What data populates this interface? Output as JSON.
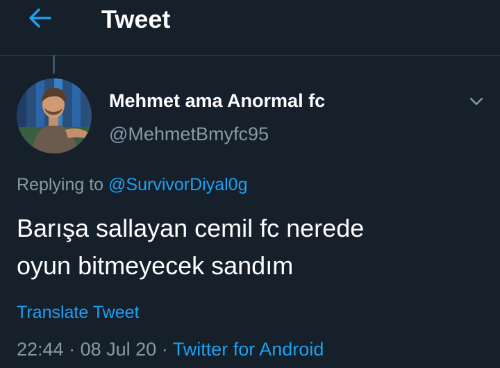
{
  "header": {
    "title": "Tweet",
    "back_icon": "arrow-left-icon"
  },
  "tweet": {
    "author": {
      "display_name": "Mehmet ama Anormal fc",
      "handle": "@MehmetBmyfc95",
      "avatar": "avatar-photo"
    },
    "menu_icon": "chevron-down-icon",
    "replying_prefix": "Replying to ",
    "replying_to": "@SurvivorDiyal0g",
    "text_line1": "Barışa sallayan cemil fc nerede",
    "text_line2": "oyun bitmeyecek sandım",
    "translate_label": "Translate Tweet",
    "time": "22:44",
    "separator": "·",
    "date": "08 Jul 20",
    "source": "Twitter for Android"
  },
  "colors": {
    "background": "#15202b",
    "accent": "#1da1f2",
    "secondary_text": "#8899a6",
    "divider": "#38444d"
  }
}
